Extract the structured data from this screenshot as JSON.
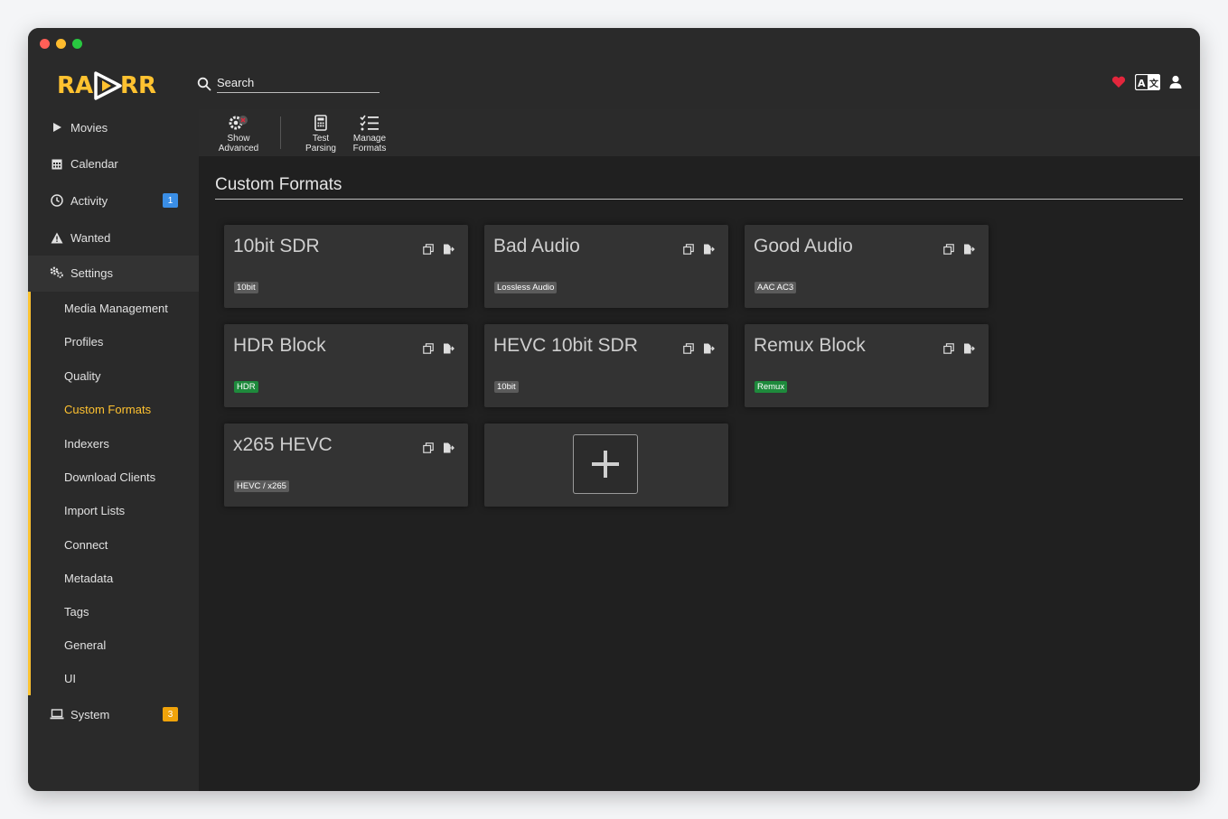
{
  "app": {
    "logo_text": "RADARR"
  },
  "search": {
    "placeholder": "Search"
  },
  "nav": {
    "movies": "Movies",
    "calendar": "Calendar",
    "activity": "Activity",
    "activity_badge": "1",
    "wanted": "Wanted",
    "settings": "Settings",
    "system": "System",
    "system_badge": "3"
  },
  "settings_items": [
    "Media Management",
    "Profiles",
    "Quality",
    "Custom Formats",
    "Indexers",
    "Download Clients",
    "Import Lists",
    "Connect",
    "Metadata",
    "Tags",
    "General",
    "UI"
  ],
  "toolbar": {
    "show_advanced_1": "Show",
    "show_advanced_2": "Advanced",
    "test_parsing_1": "Test",
    "test_parsing_2": "Parsing",
    "manage_formats_1": "Manage",
    "manage_formats_2": "Formats"
  },
  "page": {
    "title": "Custom Formats"
  },
  "formats": [
    {
      "name": "10bit SDR",
      "tag": "10bit",
      "tag_color": "#5b5b5b"
    },
    {
      "name": "Bad Audio",
      "tag": "Lossless Audio",
      "tag_color": "#5b5b5b"
    },
    {
      "name": "Good Audio",
      "tag": "AAC AC3",
      "tag_color": "#5b5b5b"
    },
    {
      "name": "HDR Block",
      "tag": "HDR",
      "tag_color": "#1e8a3c"
    },
    {
      "name": "HEVC 10bit SDR",
      "tag": "10bit",
      "tag_color": "#5b5b5b"
    },
    {
      "name": "Remux Block",
      "tag": "Remux",
      "tag_color": "#1e8a3c"
    },
    {
      "name": "x265 HEVC",
      "tag": "HEVC / x265",
      "tag_color": "#5b5b5b"
    }
  ],
  "colors": {
    "accent": "#ffc230",
    "badge_blue": "#3a8ee6",
    "badge_orange": "#f0a30a",
    "heart": "#e3263c"
  }
}
